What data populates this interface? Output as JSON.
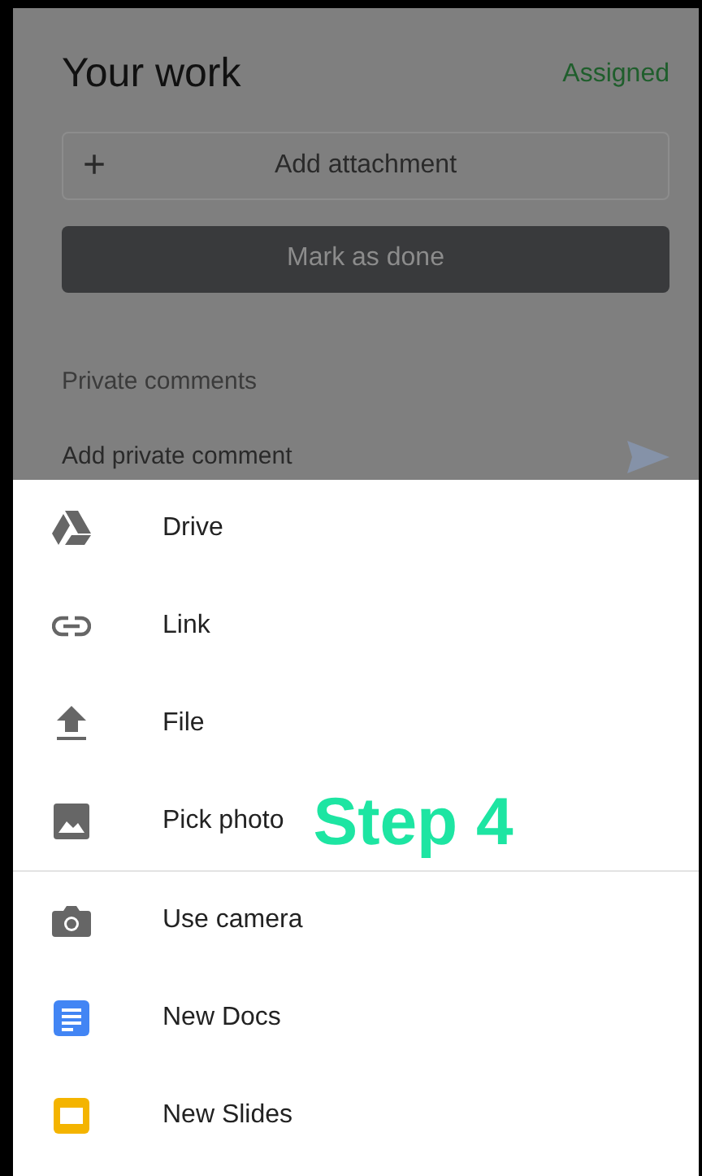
{
  "your_work": {
    "title": "Your work",
    "status": "Assigned",
    "attach_button": {
      "icon": "+",
      "label": "Add attachment"
    },
    "done_button": "Mark as done",
    "comments_heading": "Private comments",
    "comment_field": {
      "placeholder": "Add private comment"
    }
  },
  "sheet": {
    "sections": [
      {
        "items": [
          {
            "label": "Drive"
          },
          {
            "label": "Link"
          },
          {
            "label": "File"
          },
          {
            "label": "Pick photo",
            "annotation": "Step 4"
          }
        ]
      },
      {
        "items": [
          {
            "label": "Use camera"
          },
          {
            "label": "New Docs"
          },
          {
            "label": "New Slides"
          }
        ]
      }
    ]
  }
}
